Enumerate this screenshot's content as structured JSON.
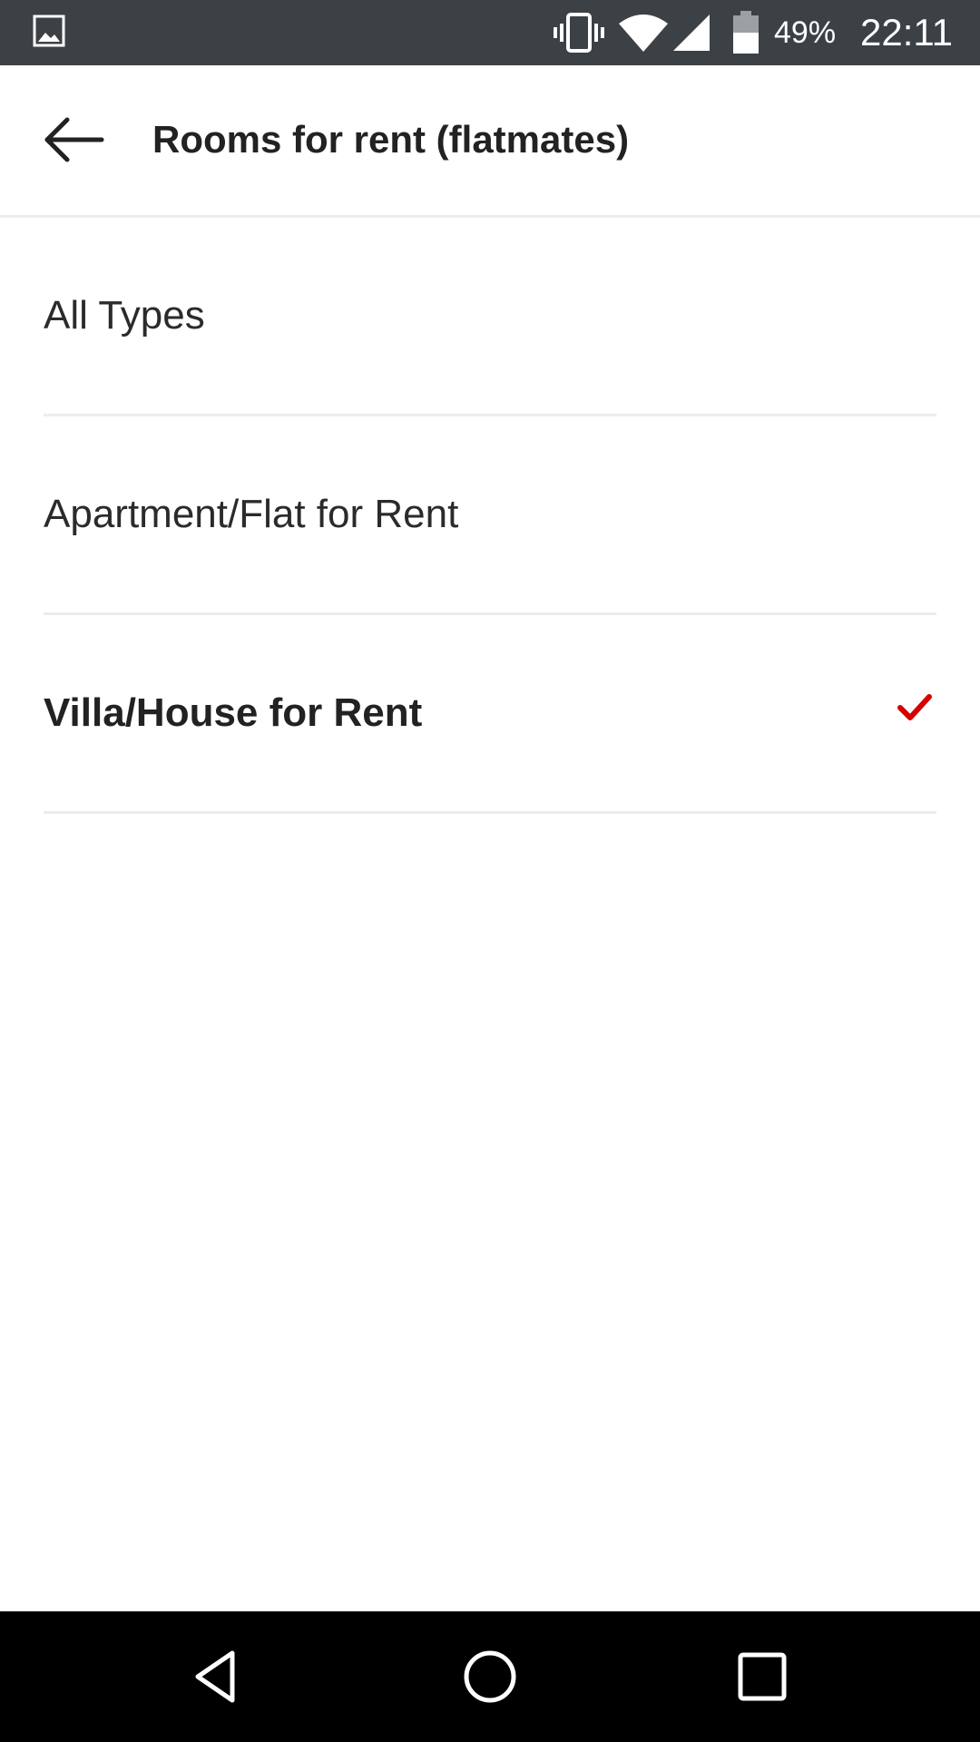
{
  "status_bar": {
    "battery_percent": "49%",
    "time": "22:11",
    "icons": [
      "image-icon",
      "vibrate-icon",
      "wifi-icon",
      "signal-icon",
      "battery-icon"
    ]
  },
  "app_bar": {
    "title": "Rooms for rent (flatmates)",
    "back_icon": "arrow-back-icon"
  },
  "options": [
    {
      "label": "All Types",
      "selected": false
    },
    {
      "label": "Apartment/Flat for Rent",
      "selected": false
    },
    {
      "label": "Villa/House for Rent",
      "selected": true
    }
  ],
  "colors": {
    "status_bar_bg": "#3c4145",
    "accent_check": "#d50000",
    "text_primary": "#222222",
    "divider": "#ececec",
    "nav_bar_bg": "#000000"
  },
  "nav_bar": {
    "icons": [
      "nav-back-icon",
      "nav-home-icon",
      "nav-recents-icon"
    ]
  }
}
